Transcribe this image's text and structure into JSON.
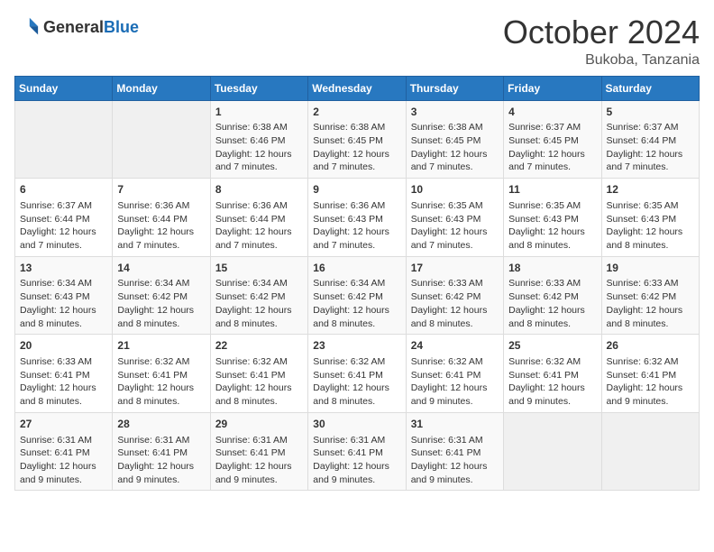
{
  "header": {
    "logo_general": "General",
    "logo_blue": "Blue",
    "month_year": "October 2024",
    "location": "Bukoba, Tanzania"
  },
  "weekdays": [
    "Sunday",
    "Monday",
    "Tuesday",
    "Wednesday",
    "Thursday",
    "Friday",
    "Saturday"
  ],
  "weeks": [
    [
      {
        "day": "",
        "empty": true
      },
      {
        "day": "",
        "empty": true
      },
      {
        "day": "1",
        "sunrise": "Sunrise: 6:38 AM",
        "sunset": "Sunset: 6:46 PM",
        "daylight": "Daylight: 12 hours and 7 minutes."
      },
      {
        "day": "2",
        "sunrise": "Sunrise: 6:38 AM",
        "sunset": "Sunset: 6:45 PM",
        "daylight": "Daylight: 12 hours and 7 minutes."
      },
      {
        "day": "3",
        "sunrise": "Sunrise: 6:38 AM",
        "sunset": "Sunset: 6:45 PM",
        "daylight": "Daylight: 12 hours and 7 minutes."
      },
      {
        "day": "4",
        "sunrise": "Sunrise: 6:37 AM",
        "sunset": "Sunset: 6:45 PM",
        "daylight": "Daylight: 12 hours and 7 minutes."
      },
      {
        "day": "5",
        "sunrise": "Sunrise: 6:37 AM",
        "sunset": "Sunset: 6:44 PM",
        "daylight": "Daylight: 12 hours and 7 minutes."
      }
    ],
    [
      {
        "day": "6",
        "sunrise": "Sunrise: 6:37 AM",
        "sunset": "Sunset: 6:44 PM",
        "daylight": "Daylight: 12 hours and 7 minutes."
      },
      {
        "day": "7",
        "sunrise": "Sunrise: 6:36 AM",
        "sunset": "Sunset: 6:44 PM",
        "daylight": "Daylight: 12 hours and 7 minutes."
      },
      {
        "day": "8",
        "sunrise": "Sunrise: 6:36 AM",
        "sunset": "Sunset: 6:44 PM",
        "daylight": "Daylight: 12 hours and 7 minutes."
      },
      {
        "day": "9",
        "sunrise": "Sunrise: 6:36 AM",
        "sunset": "Sunset: 6:43 PM",
        "daylight": "Daylight: 12 hours and 7 minutes."
      },
      {
        "day": "10",
        "sunrise": "Sunrise: 6:35 AM",
        "sunset": "Sunset: 6:43 PM",
        "daylight": "Daylight: 12 hours and 7 minutes."
      },
      {
        "day": "11",
        "sunrise": "Sunrise: 6:35 AM",
        "sunset": "Sunset: 6:43 PM",
        "daylight": "Daylight: 12 hours and 8 minutes."
      },
      {
        "day": "12",
        "sunrise": "Sunrise: 6:35 AM",
        "sunset": "Sunset: 6:43 PM",
        "daylight": "Daylight: 12 hours and 8 minutes."
      }
    ],
    [
      {
        "day": "13",
        "sunrise": "Sunrise: 6:34 AM",
        "sunset": "Sunset: 6:43 PM",
        "daylight": "Daylight: 12 hours and 8 minutes."
      },
      {
        "day": "14",
        "sunrise": "Sunrise: 6:34 AM",
        "sunset": "Sunset: 6:42 PM",
        "daylight": "Daylight: 12 hours and 8 minutes."
      },
      {
        "day": "15",
        "sunrise": "Sunrise: 6:34 AM",
        "sunset": "Sunset: 6:42 PM",
        "daylight": "Daylight: 12 hours and 8 minutes."
      },
      {
        "day": "16",
        "sunrise": "Sunrise: 6:34 AM",
        "sunset": "Sunset: 6:42 PM",
        "daylight": "Daylight: 12 hours and 8 minutes."
      },
      {
        "day": "17",
        "sunrise": "Sunrise: 6:33 AM",
        "sunset": "Sunset: 6:42 PM",
        "daylight": "Daylight: 12 hours and 8 minutes."
      },
      {
        "day": "18",
        "sunrise": "Sunrise: 6:33 AM",
        "sunset": "Sunset: 6:42 PM",
        "daylight": "Daylight: 12 hours and 8 minutes."
      },
      {
        "day": "19",
        "sunrise": "Sunrise: 6:33 AM",
        "sunset": "Sunset: 6:42 PM",
        "daylight": "Daylight: 12 hours and 8 minutes."
      }
    ],
    [
      {
        "day": "20",
        "sunrise": "Sunrise: 6:33 AM",
        "sunset": "Sunset: 6:41 PM",
        "daylight": "Daylight: 12 hours and 8 minutes."
      },
      {
        "day": "21",
        "sunrise": "Sunrise: 6:32 AM",
        "sunset": "Sunset: 6:41 PM",
        "daylight": "Daylight: 12 hours and 8 minutes."
      },
      {
        "day": "22",
        "sunrise": "Sunrise: 6:32 AM",
        "sunset": "Sunset: 6:41 PM",
        "daylight": "Daylight: 12 hours and 8 minutes."
      },
      {
        "day": "23",
        "sunrise": "Sunrise: 6:32 AM",
        "sunset": "Sunset: 6:41 PM",
        "daylight": "Daylight: 12 hours and 8 minutes."
      },
      {
        "day": "24",
        "sunrise": "Sunrise: 6:32 AM",
        "sunset": "Sunset: 6:41 PM",
        "daylight": "Daylight: 12 hours and 9 minutes."
      },
      {
        "day": "25",
        "sunrise": "Sunrise: 6:32 AM",
        "sunset": "Sunset: 6:41 PM",
        "daylight": "Daylight: 12 hours and 9 minutes."
      },
      {
        "day": "26",
        "sunrise": "Sunrise: 6:32 AM",
        "sunset": "Sunset: 6:41 PM",
        "daylight": "Daylight: 12 hours and 9 minutes."
      }
    ],
    [
      {
        "day": "27",
        "sunrise": "Sunrise: 6:31 AM",
        "sunset": "Sunset: 6:41 PM",
        "daylight": "Daylight: 12 hours and 9 minutes."
      },
      {
        "day": "28",
        "sunrise": "Sunrise: 6:31 AM",
        "sunset": "Sunset: 6:41 PM",
        "daylight": "Daylight: 12 hours and 9 minutes."
      },
      {
        "day": "29",
        "sunrise": "Sunrise: 6:31 AM",
        "sunset": "Sunset: 6:41 PM",
        "daylight": "Daylight: 12 hours and 9 minutes."
      },
      {
        "day": "30",
        "sunrise": "Sunrise: 6:31 AM",
        "sunset": "Sunset: 6:41 PM",
        "daylight": "Daylight: 12 hours and 9 minutes."
      },
      {
        "day": "31",
        "sunrise": "Sunrise: 6:31 AM",
        "sunset": "Sunset: 6:41 PM",
        "daylight": "Daylight: 12 hours and 9 minutes."
      },
      {
        "day": "",
        "empty": true
      },
      {
        "day": "",
        "empty": true
      }
    ]
  ]
}
